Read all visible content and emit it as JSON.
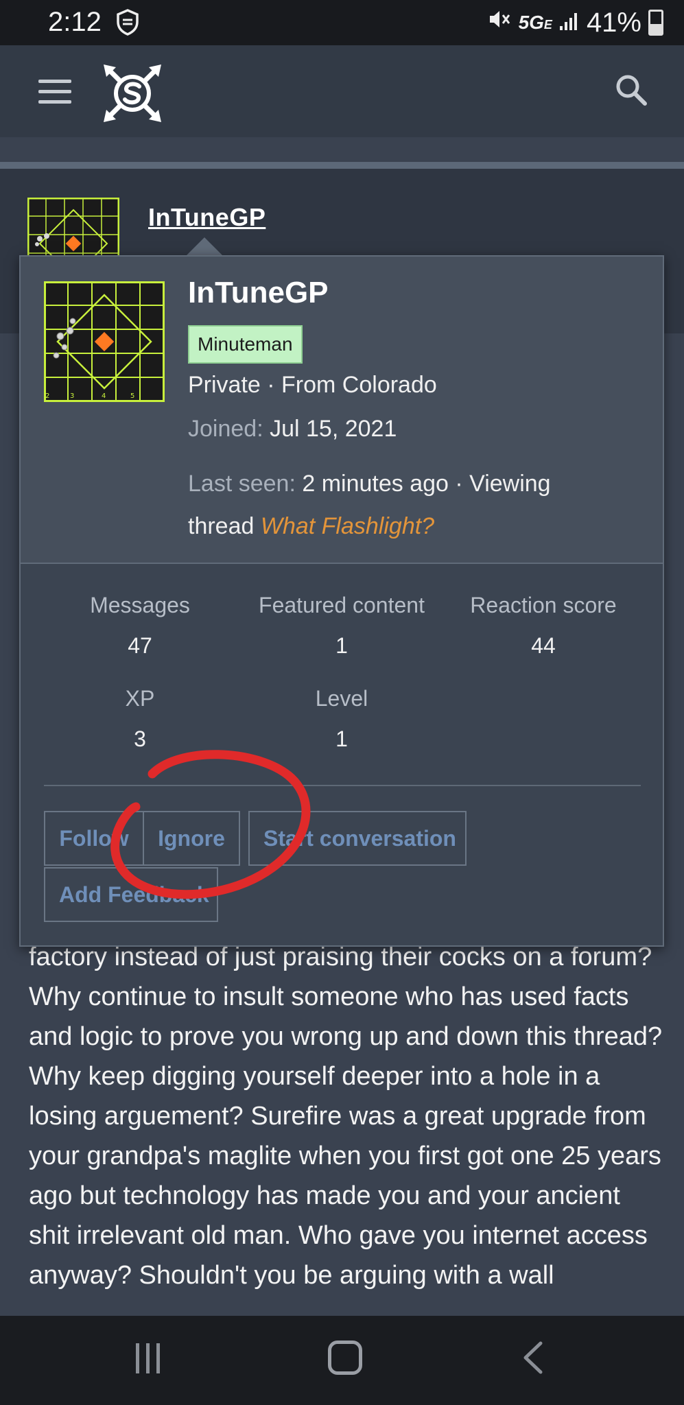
{
  "status_bar": {
    "time": "2:12",
    "network": "5G",
    "network_sub": "E",
    "battery": "41%",
    "icons": [
      "shield-icon",
      "mute-icon",
      "signal-icon",
      "battery-icon"
    ]
  },
  "app_bar": {
    "icons": [
      "menu-icon",
      "site-logo-icon",
      "search-icon"
    ]
  },
  "post": {
    "username": "InTuneGP",
    "body": "factory instead of just praising their cocks on a forum? Why continue to insult someone who has used facts and logic to prove you wrong up and down this thread? Why keep digging yourself deeper into a hole in a losing arguement? Surefire was a great upgrade from your grandpa's maglite when you first got one 25 years ago but technology has made you and your ancient shit irrelevant old man. Who gave you internet access anyway? Shouldn't you be arguing with a wall"
  },
  "profile_card": {
    "username": "InTuneGP",
    "badge": "Minuteman",
    "rank_line": "Private · From Colorado",
    "joined_label": "Joined:",
    "joined_value": "Jul 15, 2021",
    "last_seen_label": "Last seen:",
    "last_seen_value": "2 minutes ago · Viewing",
    "viewing_prefix": "thread",
    "viewing_thread": "What Flashlight?",
    "stats": {
      "messages_label": "Messages",
      "messages_value": "47",
      "featured_label": "Featured content",
      "featured_value": "1",
      "reaction_label": "Reaction score",
      "reaction_value": "44",
      "xp_label": "XP",
      "xp_value": "3",
      "level_label": "Level",
      "level_value": "1"
    },
    "buttons": {
      "follow": "Follow",
      "ignore": "Ignore",
      "start_conversation": "Start conversation",
      "add_feedback": "Add Feedback"
    }
  },
  "avatar_target_numbers": [
    "2",
    "3",
    "4",
    "5"
  ],
  "colors": {
    "accent_link": "#e4953a",
    "badge_bg": "#c2f2c4",
    "button_text": "#6f8fb9",
    "annotation_red": "#e02a2a",
    "target_green": "#c8f03c",
    "target_orange": "#ff7a22"
  },
  "nav_bar": {
    "icons": [
      "recent-apps-icon",
      "home-icon",
      "back-icon"
    ]
  }
}
